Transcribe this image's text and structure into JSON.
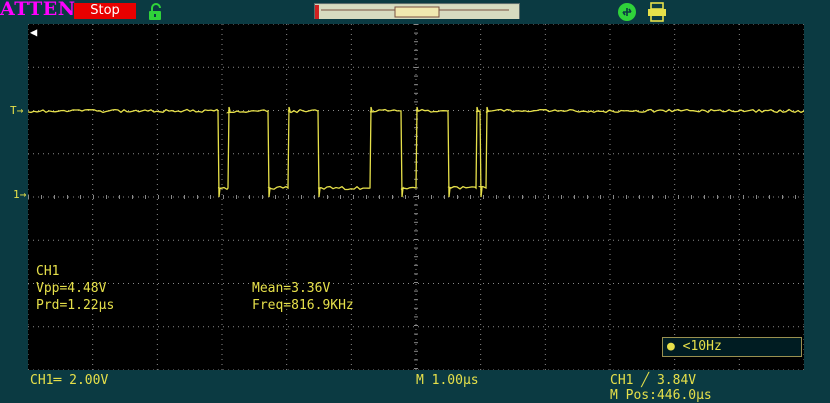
{
  "top_bar": {
    "brand": "ATTEN",
    "run_state": "Stop",
    "icons": [
      "lock-icon",
      "usb-icon",
      "printer-icon"
    ]
  },
  "colors": {
    "background": "#0b3a42",
    "screen": "#000000",
    "grid": "#7a7a7a",
    "trace": "#e6e04a",
    "brand": "#ff00ff",
    "stop": "#e80000"
  },
  "markers": {
    "trigger": "T",
    "channel": "1"
  },
  "measurements": {
    "channel": "CH1",
    "vpp": "Vpp=4.48V",
    "prd": "Prd=1.22μs",
    "mean": "Mean=3.36V",
    "freq": "Freq=816.9KHz"
  },
  "freq_counter": "<10Hz",
  "status": {
    "ch1_scale": "CH1═ 2.00V",
    "timebase": "M 1.00μs",
    "trigger": "CH1 ╱ 3.84V",
    "mpos": "M Pos:446.0μs"
  }
}
